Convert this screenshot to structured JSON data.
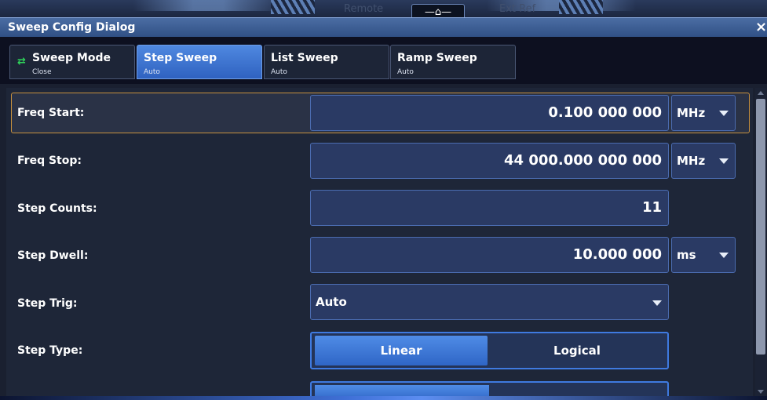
{
  "status_bar": {
    "remote_label": "Remote",
    "ext_ref_label": "Ext Ref"
  },
  "dialog": {
    "title": "Sweep Config Dialog",
    "close_glyph": "×"
  },
  "tabs": [
    {
      "label": "Sweep Mode",
      "sub": "Close",
      "icon": "sync-icon",
      "active": false
    },
    {
      "label": "Step Sweep",
      "sub": "Auto",
      "active": true
    },
    {
      "label": "List Sweep",
      "sub": "Auto",
      "active": false
    },
    {
      "label": "Ramp Sweep",
      "sub": "Auto",
      "active": false
    }
  ],
  "rows": {
    "freq_start": {
      "label": "Freq Start:",
      "value": "0.100 000 000",
      "unit": "MHz"
    },
    "freq_stop": {
      "label": "Freq Stop:",
      "value": "44 000.000 000 000",
      "unit": "MHz"
    },
    "step_counts": {
      "label": "Step Counts:",
      "value": "11"
    },
    "step_dwell": {
      "label": "Step Dwell:",
      "value": "10.000 000",
      "unit": "ms"
    },
    "step_trig": {
      "label": "Step Trig:",
      "value": "Auto"
    },
    "step_type": {
      "label": "Step Type:",
      "options": [
        "Linear",
        "Logical"
      ],
      "selected": "Linear"
    }
  },
  "colors": {
    "accent": "#3f7ae0",
    "selection_border": "#c8913e",
    "sync_icon": "#2fd35a"
  }
}
